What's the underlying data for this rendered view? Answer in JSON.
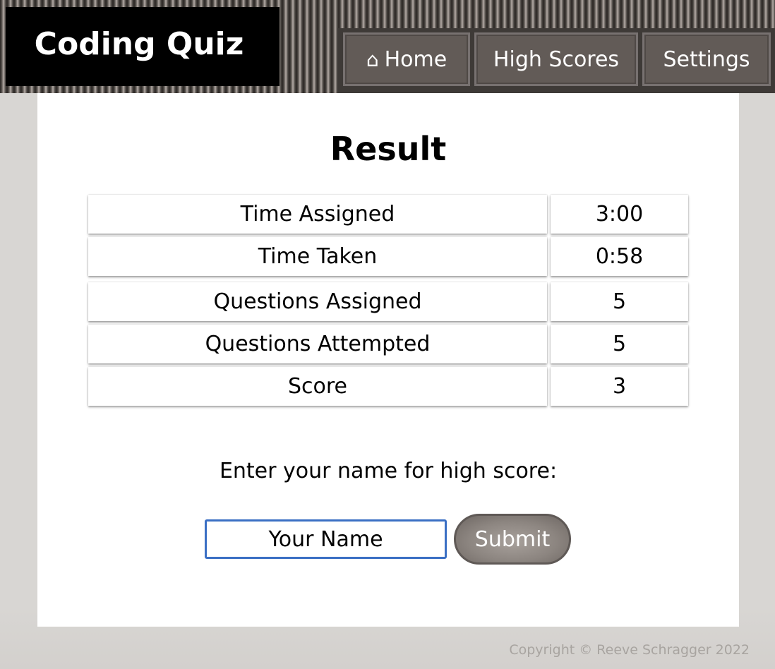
{
  "header": {
    "app_title": "Coding Quiz",
    "nav": {
      "home_icon": "⌂",
      "home_label": "Home",
      "high_scores_label": "High Scores",
      "settings_label": "Settings"
    }
  },
  "result": {
    "title": "Result",
    "rows": [
      {
        "label": "Time Assigned",
        "value": "3:00"
      },
      {
        "label": "Time Taken",
        "value": "0:58"
      },
      {
        "label": "Questions Assigned",
        "value": "5"
      },
      {
        "label": "Questions Attempted",
        "value": "5"
      },
      {
        "label": "Score",
        "value": "3"
      }
    ]
  },
  "form": {
    "prompt": "Enter your name for high score:",
    "name_value": "Your Name",
    "submit_label": "Submit"
  },
  "footer": {
    "copyright": "Copyright © Reeve Schragger 2022"
  },
  "colors": {
    "header_dark": "#000000",
    "nav_button": "#625b57",
    "input_focus_border": "#3a6fc4",
    "submit_button": "#8c8580"
  }
}
